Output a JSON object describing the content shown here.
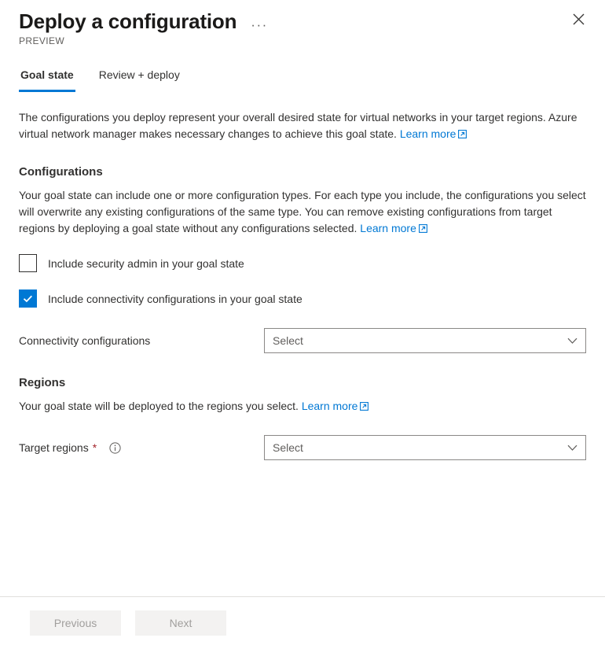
{
  "header": {
    "title": "Deploy a configuration",
    "more_label": "···",
    "preview_badge": "PREVIEW",
    "close_icon": "close-icon"
  },
  "tabs": [
    {
      "label": "Goal state",
      "active": true
    },
    {
      "label": "Review + deploy",
      "active": false
    }
  ],
  "intro": {
    "text": "The configurations you deploy represent your overall desired state for virtual networks in your target regions. Azure virtual network manager makes necessary changes to achieve this goal state. ",
    "link_label": "Learn more"
  },
  "configurations": {
    "heading": "Configurations",
    "description": "Your goal state can include one or more configuration types. For each type you include, the configurations you select will overwrite any existing configurations of the same type. You can remove existing configurations from target regions by deploying a goal state without any configurations selected. ",
    "link_label": "Learn more",
    "checkboxes": [
      {
        "label": "Include security admin in your goal state",
        "checked": false
      },
      {
        "label": "Include connectivity configurations in your goal state",
        "checked": true
      }
    ],
    "connectivity_field": {
      "label": "Connectivity configurations",
      "placeholder": "Select",
      "value": ""
    }
  },
  "regions": {
    "heading": "Regions",
    "description": "Your goal state will be deployed to the regions you select. ",
    "link_label": "Learn more",
    "target_field": {
      "label": "Target regions",
      "required_marker": "*",
      "info_icon": "info-icon",
      "placeholder": "Select",
      "value": ""
    }
  },
  "footer": {
    "previous_label": "Previous",
    "next_label": "Next"
  },
  "colors": {
    "accent": "#0078d4",
    "link": "#0078d4",
    "required": "#a4262c",
    "text": "#323130",
    "muted": "#605e5c",
    "disabled_button_bg": "#f3f2f1",
    "disabled_button_text": "#a19f9d"
  }
}
